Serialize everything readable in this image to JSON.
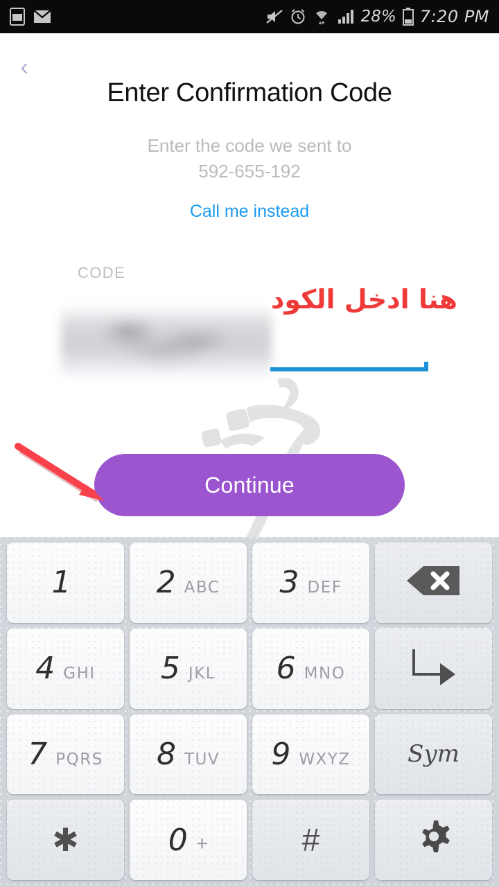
{
  "status_bar": {
    "left_icons": [
      "screenshot-icon",
      "email-icon"
    ],
    "right_icons": [
      "mute-icon",
      "alarm-icon",
      "wifi-icon",
      "signal-icon",
      "battery-icon"
    ],
    "battery_percent": "28%",
    "time": "7:20 PM"
  },
  "nav": {
    "back_label": "‹"
  },
  "header": {
    "title": "Enter Confirmation Code",
    "subtitle_line1": "Enter the code we sent to",
    "phone": "592-655-192",
    "call_link": "Call me instead"
  },
  "form": {
    "code_label": "CODE",
    "code_value": "",
    "code_placeholder": "",
    "underline_color": "#1b92d8"
  },
  "actions": {
    "continue_label": "Continue",
    "continue_color": "#9b55cf"
  },
  "annotations": {
    "arabic_note": "هنا ادخل الكود",
    "arabic_note_color": "#f03a3a",
    "arrow_color": "#f8414b",
    "arrow_target": "continue-button"
  },
  "keyboard": {
    "rows": [
      [
        {
          "digit": "1",
          "letters": "",
          "type": "digit"
        },
        {
          "digit": "2",
          "letters": "ABC",
          "type": "digit"
        },
        {
          "digit": "3",
          "letters": "DEF",
          "type": "digit"
        },
        {
          "digit": "",
          "letters": "",
          "type": "backspace",
          "icon": "backspace-icon"
        }
      ],
      [
        {
          "digit": "4",
          "letters": "GHI",
          "type": "digit"
        },
        {
          "digit": "5",
          "letters": "JKL",
          "type": "digit"
        },
        {
          "digit": "6",
          "letters": "MNO",
          "type": "digit"
        },
        {
          "digit": "",
          "letters": "",
          "type": "enter",
          "icon": "enter-arrow-icon"
        }
      ],
      [
        {
          "digit": "7",
          "letters": "PQRS",
          "type": "digit"
        },
        {
          "digit": "8",
          "letters": "TUV",
          "type": "digit"
        },
        {
          "digit": "9",
          "letters": "WXYZ",
          "type": "digit"
        },
        {
          "digit": "",
          "letters": "",
          "type": "sym",
          "label": "Sym"
        }
      ],
      [
        {
          "digit": "✱",
          "letters": "",
          "type": "star"
        },
        {
          "digit": "0",
          "letters": "+",
          "type": "digit"
        },
        {
          "digit": "#",
          "letters": "",
          "type": "hash"
        },
        {
          "digit": "",
          "letters": "",
          "type": "settings",
          "icon": "gear-icon"
        }
      ]
    ]
  }
}
